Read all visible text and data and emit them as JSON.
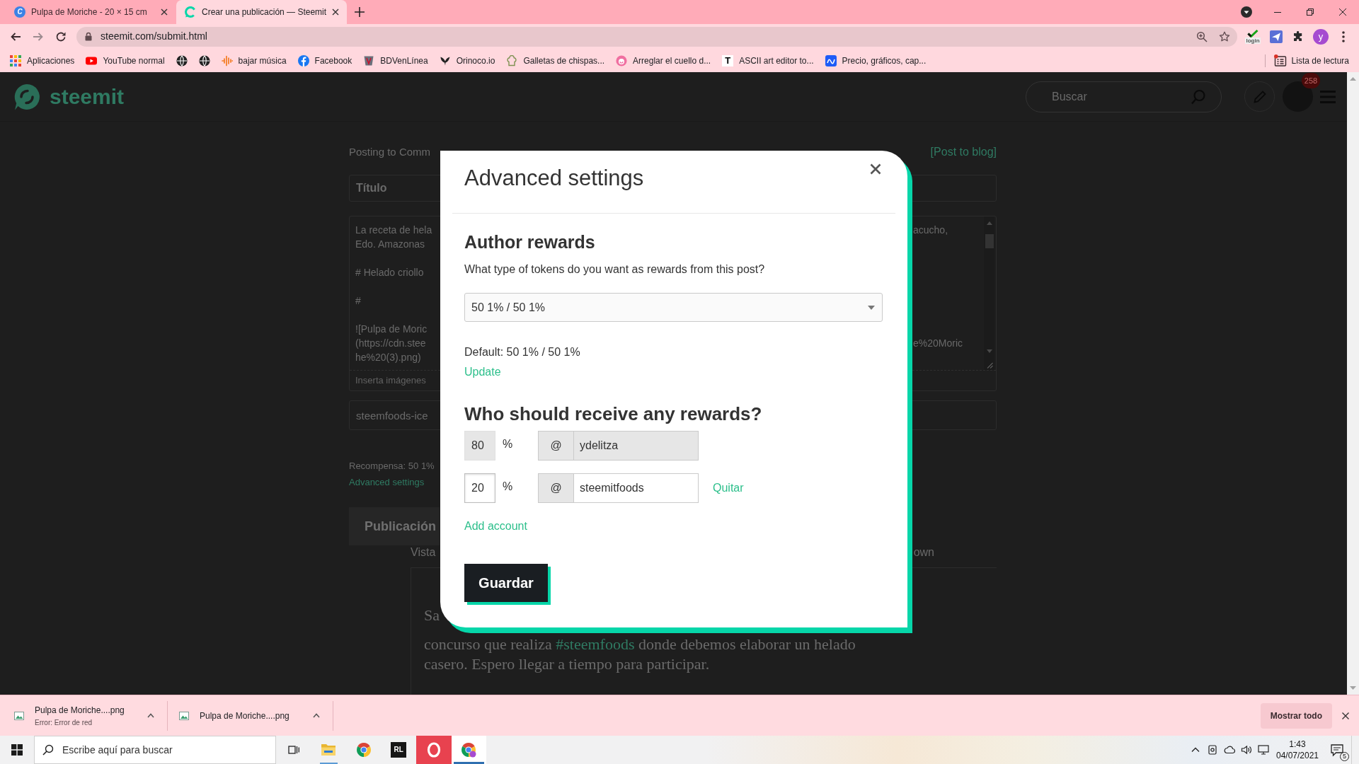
{
  "browser": {
    "tabs": [
      {
        "title": "Pulpa de Moriche - 20 × 15 cm",
        "icon_letter": "C",
        "selected": false
      },
      {
        "title": "Crear una publicación — Steemit",
        "selected": true
      }
    ],
    "url": "steemit.com/submit.html",
    "extension_label": "login",
    "profile_initial": "y",
    "bookmarks": [
      {
        "kind": "labeled",
        "label": "Aplicaciones"
      },
      {
        "kind": "labeled",
        "label": "YouTube normal"
      },
      {
        "kind": "icon_only"
      },
      {
        "kind": "icon_only"
      },
      {
        "kind": "labeled",
        "label": "bajar música"
      },
      {
        "kind": "labeled",
        "label": "Facebook"
      },
      {
        "kind": "labeled",
        "label": "BDVenLínea"
      },
      {
        "kind": "labeled",
        "label": "Orinoco.io"
      },
      {
        "kind": "labeled",
        "label": "Galletas de chispas..."
      },
      {
        "kind": "labeled",
        "label": "Arreglar el cuello d..."
      },
      {
        "kind": "labeled",
        "label": "ASCII art editor to...",
        "icon_letter": "T"
      },
      {
        "kind": "labeled",
        "label": "Precio, gráficos, cap..."
      }
    ],
    "reading_list": "Lista de lectura"
  },
  "site": {
    "logo_text": "steemit",
    "search_placeholder": "Buscar",
    "notification_count": "258"
  },
  "editor": {
    "posting_to": "Posting to Comm",
    "post_to_blog": "[Post to blog]",
    "title_placeholder": "Título",
    "body": [
      {
        "lines": [
          {
            "left": "La receta de hela",
            "right": "acucho,"
          },
          {
            "left": "Edo. Amazonas"
          }
        ]
      },
      {
        "lines": [
          {
            "left": "# Helado criollo"
          }
        ]
      },
      {
        "lines": [
          {
            "left": "#"
          }
        ]
      },
      {
        "lines": [
          {
            "left": "![Pulpa de Moric"
          },
          {
            "left": "(https://cdn.stee",
            "right": "e%20Moric"
          },
          {
            "left": "he%20(3).png)"
          }
        ]
      }
    ],
    "body_hint": "Inserta imágenes",
    "tags": "steemfoods-ice",
    "reward_summary": "Recompensa: 50 1%",
    "advanced_link": "Advanced settings",
    "publish_button": "Publicación",
    "preview_label": "Vista",
    "preview_hint": "own",
    "preview_start": "Sa",
    "preview_lines": [
      [
        {
          "kind": "text",
          "text": "concurso que realiza"
        },
        {
          "kind": "link",
          "text": "#steemfoods"
        },
        {
          "kind": "text",
          "text": "donde debemos elaborar un helado"
        }
      ],
      [
        {
          "kind": "text",
          "text": "casero. Espero llegar a tiempo para participar."
        }
      ]
    ]
  },
  "modal": {
    "title": "Advanced settings",
    "rewards_heading": "Author rewards",
    "rewards_question": "What type of tokens do you want as rewards from this post?",
    "rewards_option": "50 1% / 50 1%",
    "rewards_default": "Default: 50 1% / 50 1%",
    "update_link": "Update",
    "beneficiaries_heading": "Who should receive any rewards?",
    "beneficiaries": [
      {
        "percent": "80",
        "percent_sign": "%",
        "at_sign": "@",
        "account": "ydelitza",
        "disabled": true
      },
      {
        "percent": "20",
        "percent_sign": "%",
        "at_sign": "@",
        "account": "steemitfoods",
        "disabled": false,
        "remove_link": "Quitar"
      }
    ],
    "add_account": "Add account",
    "save_button": "Guardar"
  },
  "downloads": {
    "items": [
      {
        "filename": "Pulpa de Moriche....png",
        "status": "Error: Error de red"
      },
      {
        "filename": "Pulpa de Moriche....png"
      }
    ],
    "show_all": "Mostrar todo"
  },
  "taskbar": {
    "search_placeholder": "Escribe aquí para buscar",
    "apps": [
      {
        "running": true,
        "selected": false,
        "flashing": false
      },
      {
        "running": false,
        "selected": false,
        "flashing": false
      },
      {
        "running": false,
        "selected": false,
        "flashing": false,
        "icon_text": "RL"
      },
      {
        "running": false,
        "selected": false,
        "flashing": true
      },
      {
        "running": true,
        "selected": true,
        "flashing": false
      }
    ],
    "time": "1:43",
    "date": "04/07/2021",
    "notification_count": "5"
  }
}
